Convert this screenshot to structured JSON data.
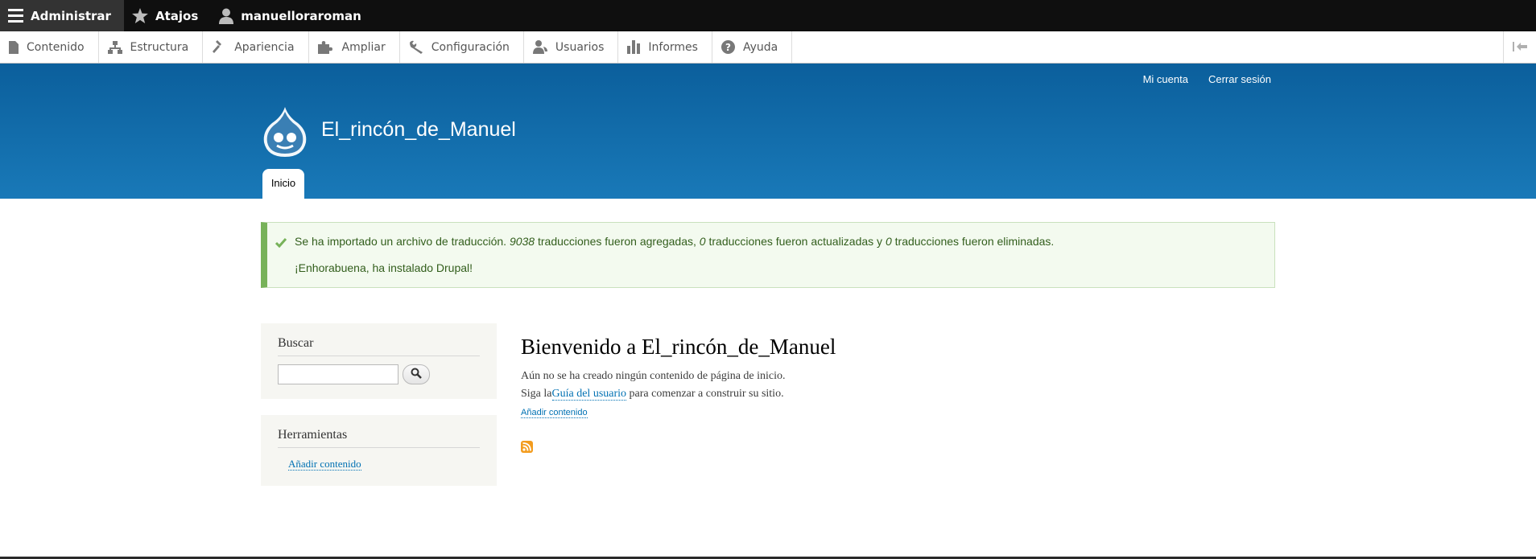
{
  "toolbar": {
    "administer_label": "Administrar",
    "shortcuts_label": "Atajos",
    "user_label": "manuelloraroman"
  },
  "tray": {
    "items": [
      {
        "label": "Contenido",
        "icon": "file-icon"
      },
      {
        "label": "Estructura",
        "icon": "sitemap-icon"
      },
      {
        "label": "Apariencia",
        "icon": "paintbrush-icon"
      },
      {
        "label": "Ampliar",
        "icon": "puzzle-icon"
      },
      {
        "label": "Configuración",
        "icon": "wrench-icon"
      },
      {
        "label": "Usuarios",
        "icon": "people-icon"
      },
      {
        "label": "Informes",
        "icon": "bar-chart-icon"
      },
      {
        "label": "Ayuda",
        "icon": "help-icon"
      }
    ]
  },
  "header": {
    "my_account": "Mi cuenta",
    "logout": "Cerrar sesión",
    "site_name": "El_rincón_de_Manuel",
    "tab_home": "Inicio"
  },
  "messages": {
    "line1_a": "Se ha importado un archivo de traducción. ",
    "added_count": "9038",
    "line1_b": " traducciones fueron agregadas, ",
    "updated_count": "0",
    "line1_c": " traducciones fueron actualizadas y ",
    "deleted_count": "0",
    "line1_d": " traducciones fueron eliminadas.",
    "line2": "¡Enhorabuena, ha instalado Drupal!"
  },
  "sidebar": {
    "search_title": "Buscar",
    "tools_title": "Herramientas",
    "tools_link": "Añadir contenido"
  },
  "main": {
    "title": "Bienvenido a El_rincón_de_Manuel",
    "text1": "Aún no se ha creado ningún contenido de página de inicio.",
    "text2_a": "Siga la",
    "text2_link": "Guía del usuario",
    "text2_b": " para comenzar a construir su sitio.",
    "add_content": "Añadir contenido"
  },
  "colors": {
    "header_top": "#0b5f9c",
    "header_bottom": "#1979b8",
    "success_border": "#77b259",
    "success_text": "#325e1c",
    "link": "#0071b3"
  }
}
